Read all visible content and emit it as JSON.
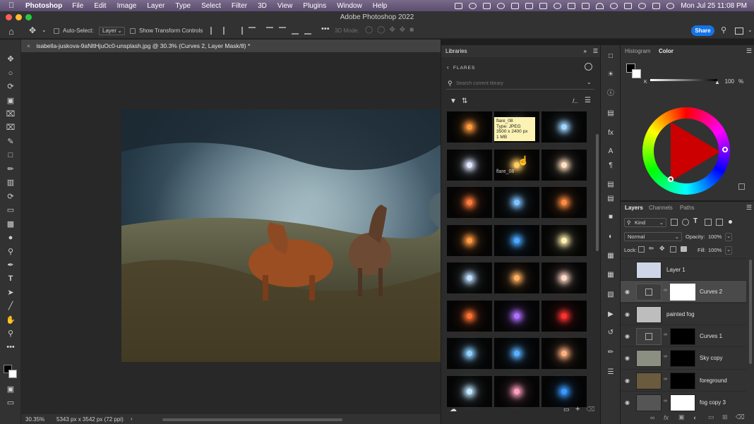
{
  "menubar": {
    "app": "Photoshop",
    "items": [
      "File",
      "Edit",
      "Image",
      "Layer",
      "Type",
      "Select",
      "Filter",
      "3D",
      "View",
      "Plugins",
      "Window",
      "Help"
    ],
    "clock": "Mon Jul 25  11:08 PM"
  },
  "window": {
    "title": "Adobe Photoshop 2022"
  },
  "options": {
    "auto_select_label": "Auto-Select:",
    "auto_select_value": "Layer",
    "transform_label": "Show Transform Controls",
    "mode_label": "3D Mode:",
    "share_label": "Share"
  },
  "document": {
    "tab_title": "isabella-juskova-9aNltHjuOc0-unsplash.jpg @ 30.3% (Curves 2, Layer Mask/8) *",
    "zoom": "30.35%",
    "info": "5343 px x 3542 px (72 ppi)"
  },
  "libraries": {
    "tab": "Libraries",
    "breadcrumb": "FLARES",
    "search_placeholder": "Search current library",
    "tooltip": {
      "name": "flare_08",
      "type": "Type: JPEG",
      "size": "3500 x 2400 px",
      "filesize": "1 MB"
    },
    "hover_caption": "flare_08",
    "flares": [
      {
        "color": "#ff9a3c"
      },
      {
        "color": "#ffffff"
      },
      {
        "color": "#9fd6ff"
      },
      {
        "color": "#dfe6ff"
      },
      {
        "color": "#ffcc66"
      },
      {
        "color": "#ffe0c0"
      },
      {
        "color": "#ff7a3a"
      },
      {
        "color": "#7fc4ff"
      },
      {
        "color": "#ff8a40"
      },
      {
        "color": "#ff9a40"
      },
      {
        "color": "#4aa8ff"
      },
      {
        "color": "#fff0b0"
      },
      {
        "color": "#bfe0ff"
      },
      {
        "color": "#ffb060"
      },
      {
        "color": "#ffd8c8"
      },
      {
        "color": "#ff7030"
      },
      {
        "color": "#b070ff"
      },
      {
        "color": "#ff3030"
      },
      {
        "color": "#8fd0ff"
      },
      {
        "color": "#5ab0ff"
      },
      {
        "color": "#ffb080"
      },
      {
        "color": "#bfe8ff"
      },
      {
        "color": "#ffa0c0"
      },
      {
        "color": "#3a9aff"
      }
    ]
  },
  "color_panel": {
    "tabs": [
      "Histogram",
      "Color"
    ],
    "k_label": "K",
    "k_value": "100",
    "k_unit": "%"
  },
  "layers_panel": {
    "tabs": [
      "Layers",
      "Channels",
      "Paths"
    ],
    "kind_label": "Kind",
    "blend_mode": "Normal",
    "opacity_label": "Opacity:",
    "opacity_value": "100%",
    "lock_label": "Lock:",
    "fill_label": "Fill:",
    "fill_value": "100%",
    "layers": [
      {
        "name": "Layer 1",
        "visible": false,
        "selected": false,
        "thumb": "#cfd6e8",
        "mask": null
      },
      {
        "name": "Curves 2",
        "visible": true,
        "selected": true,
        "thumb": "adj",
        "mask": "#ffffff"
      },
      {
        "name": "painted fog",
        "visible": true,
        "selected": false,
        "thumb": "#bdbdbd",
        "mask": null
      },
      {
        "name": "Curves 1",
        "visible": true,
        "selected": false,
        "thumb": "adj",
        "mask": "#000000"
      },
      {
        "name": "Sky copy",
        "visible": true,
        "selected": false,
        "thumb": "#8b8f82",
        "mask": "#000000"
      },
      {
        "name": "foreground",
        "visible": true,
        "selected": false,
        "thumb": "#6a5a3e",
        "mask": "#000000"
      },
      {
        "name": "fog copy 3",
        "visible": true,
        "selected": false,
        "thumb": "#555555",
        "mask": "#ffffff"
      }
    ]
  }
}
